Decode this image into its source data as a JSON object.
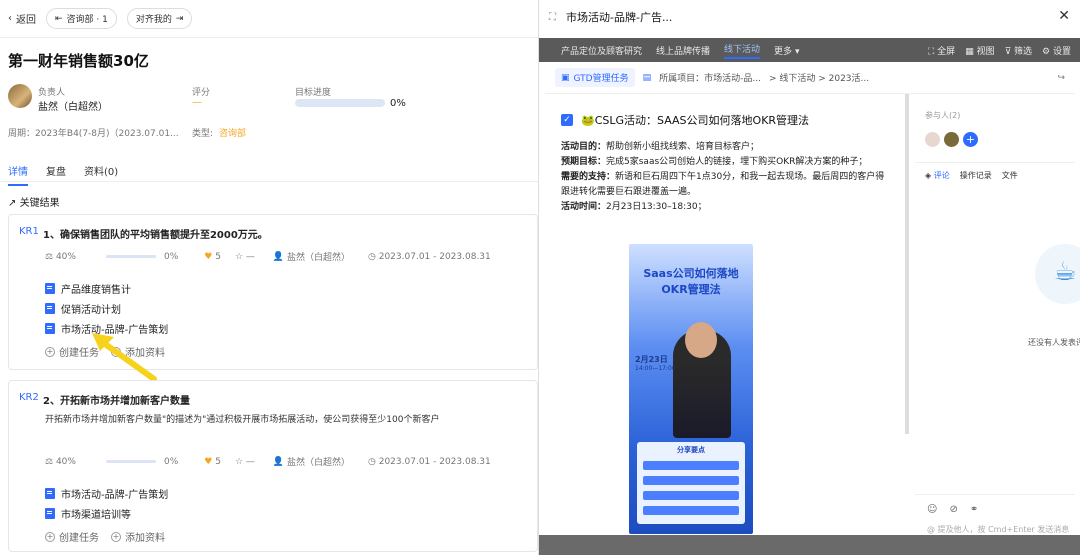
{
  "left": {
    "back_label": "返回",
    "team_pill": "咨询部 · 1",
    "align_pill": "对齐我的",
    "title": "第一财年销售额30亿",
    "owner_label": "负责人",
    "owner_value": "盐然（白超然）",
    "score_label": "评分",
    "score_value": "—",
    "progress_label": "目标进度",
    "progress_value": "0%",
    "period": "周期：2023年B4(7-8月)（2023.07.01...",
    "type_label": "类型:",
    "type_value": "咨询部",
    "tabs": [
      "详情",
      "复盘",
      "资料(0)"
    ],
    "key_results_label": "关键结果",
    "kr1": {
      "tag": "KR1",
      "title": "1、确保销售团队的平均销售额提升至2000万元。",
      "weight": "40%",
      "progress": "0%",
      "confidence": "5",
      "star": "—",
      "owner": "盐然（白超然）",
      "date": "2023.07.01 - 2023.08.31",
      "tasks": [
        "产品维度销售计",
        "促销活动计划",
        "市场活动-品牌-广告策划"
      ],
      "create_task": "创建任务",
      "add_material": "添加资料"
    },
    "kr2": {
      "tag": "KR2",
      "title": "2、开拓新市场并增加新客户数量",
      "desc": "开拓新市场并增加新客户数量\"的描述为\"通过积极开展市场拓展活动，使公司获得至少100个新客户",
      "weight": "40%",
      "progress": "0%",
      "confidence": "5",
      "star": "—",
      "owner": "盐然（白超然）",
      "date": "2023.07.01 - 2023.08.31",
      "tasks": [
        "市场活动-品牌-广告策划",
        "市场渠道培训等"
      ],
      "create_task": "创建任务",
      "add_material": "添加资料"
    }
  },
  "right": {
    "title": "市场活动-品牌-广告...",
    "gray_tabs": [
      "产品定位及顾客研究",
      "线上品牌传播",
      "线下活动",
      "更多"
    ],
    "gray_active": "线下活动",
    "gray_actions": [
      "全屏",
      "视图",
      "筛选",
      "设置"
    ],
    "gtd_label": "GTD管理任务",
    "project_crumb": "所属项目：市场活动-品...",
    "crumb_tail": "> 线下活动 > 2023活...",
    "task_title": "🐸CSLG活动：SAAS公司如何落地OKR管理法",
    "desc": {
      "goal_label": "活动目的：",
      "goal": "帮助创新小组找线索、培育目标客户；",
      "target_label": "预期目标：",
      "target": "完成5家saas公司创始人的链接，埋下购买OKR解决方案的种子；",
      "support_label": "需要的支持：",
      "support": "新语和巨石周四下午1点30分，和我一起去现场。最后周四的客户得跟进转化需要巨石跟进覆盖一遍。",
      "time_label": "活动时间：",
      "time": "2月23日13:30–18:30；"
    },
    "poster": {
      "title": "Saas公司如何落地OKR管理法",
      "date": "2月23日",
      "time": "14:00—17:00",
      "share": "分享要点"
    },
    "participants_label": "参与人(2)",
    "side_tabs": [
      "评论",
      "操作记录",
      "文件"
    ],
    "no_comment": "还没有人发表评",
    "comment_placeholder": "@ 提及他人，按 Cmd+Enter 发送消息"
  }
}
